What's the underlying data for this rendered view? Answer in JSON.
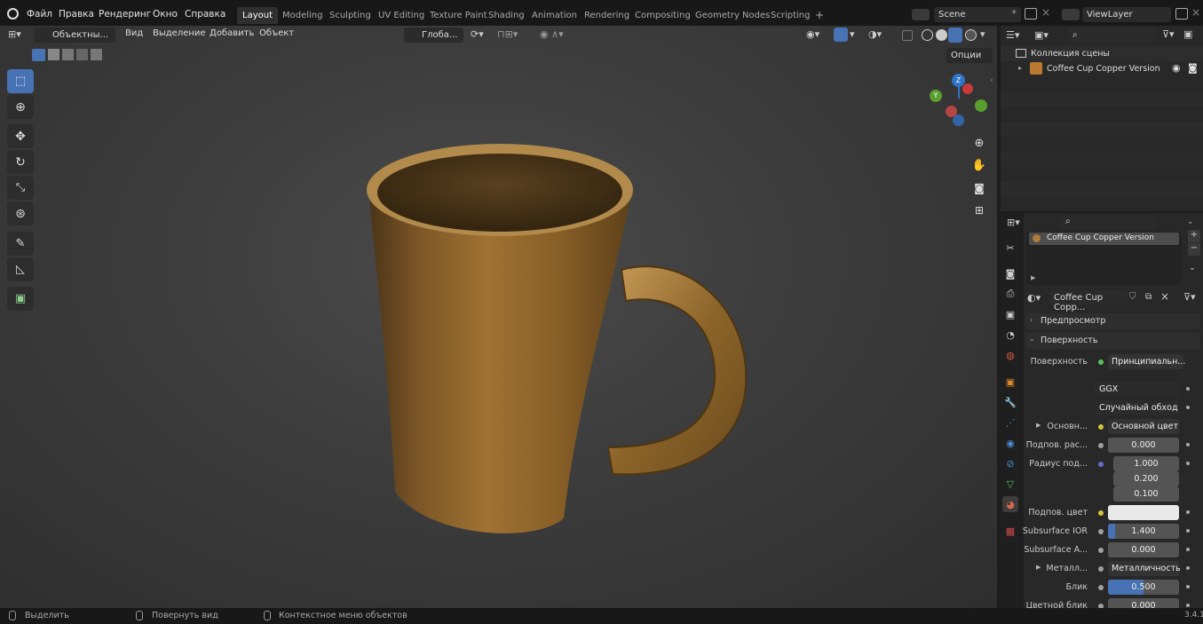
{
  "menu": {
    "items": [
      "Файл",
      "Правка",
      "Рендеринг",
      "Окно",
      "Справка"
    ]
  },
  "workspaces": [
    "Layout",
    "Modeling",
    "Sculpting",
    "UV Editing",
    "Texture Paint",
    "Shading",
    "Animation",
    "Rendering",
    "Compositing",
    "Geometry Nodes",
    "Scripting"
  ],
  "workspace_add": "+",
  "scene": "Scene",
  "view_layer": "ViewLayer",
  "viewport": {
    "mode": "Объектны...",
    "menus": [
      "Вид",
      "Выделение",
      "Добавить",
      "Объект"
    ],
    "orientation": "Глоба...",
    "options": "Опции"
  },
  "gizmo": {
    "z": "Z",
    "y": "Y"
  },
  "outliner": {
    "collection": "Коллекция сцены",
    "object": "Coffee Cup Copper Version"
  },
  "material": {
    "slot": "Coffee Cup Copper Version",
    "name": "Coffee Cup Copp..."
  },
  "panels": {
    "preview": "Предпросмотр",
    "surface": "Поверхность"
  },
  "surface": {
    "label": "Поверхность",
    "shader": "Принципиальн...",
    "distribution": "GGX",
    "subsurface_method": "Случайный обход"
  },
  "rows": [
    {
      "label": "Основн...",
      "value": "Основной цвет",
      "kind": "link"
    },
    {
      "label": "Подпов. рас...",
      "value": "0.000",
      "kind": "num"
    },
    {
      "label": "Радиус под...",
      "value": "1.000",
      "kind": "num"
    },
    {
      "label": "",
      "value": "0.200",
      "kind": "num"
    },
    {
      "label": "",
      "value": "0.100",
      "kind": "num"
    },
    {
      "label": "Подпов. цвет",
      "value": "",
      "kind": "color"
    },
    {
      "label": "Subsurface IOR",
      "value": "1.400",
      "kind": "slider"
    },
    {
      "label": "Subsurface A...",
      "value": "0.000",
      "kind": "num"
    },
    {
      "label": "Металл...",
      "value": "Металличность",
      "kind": "link"
    },
    {
      "label": "Блик",
      "value": "0.500",
      "kind": "slider"
    },
    {
      "label": "Цветной блик",
      "value": "0.000",
      "kind": "num"
    }
  ],
  "subsurface_ior_fill": 0.1,
  "specular_fill": 0.5,
  "status": {
    "select": "Выделить",
    "rotate": "Повернуть вид",
    "context": "Контекстное меню объектов",
    "version": "3.4.1"
  },
  "colors": {
    "accent": "#4772b3",
    "active_tab": "#303030",
    "copper": "#9a6a2e"
  }
}
